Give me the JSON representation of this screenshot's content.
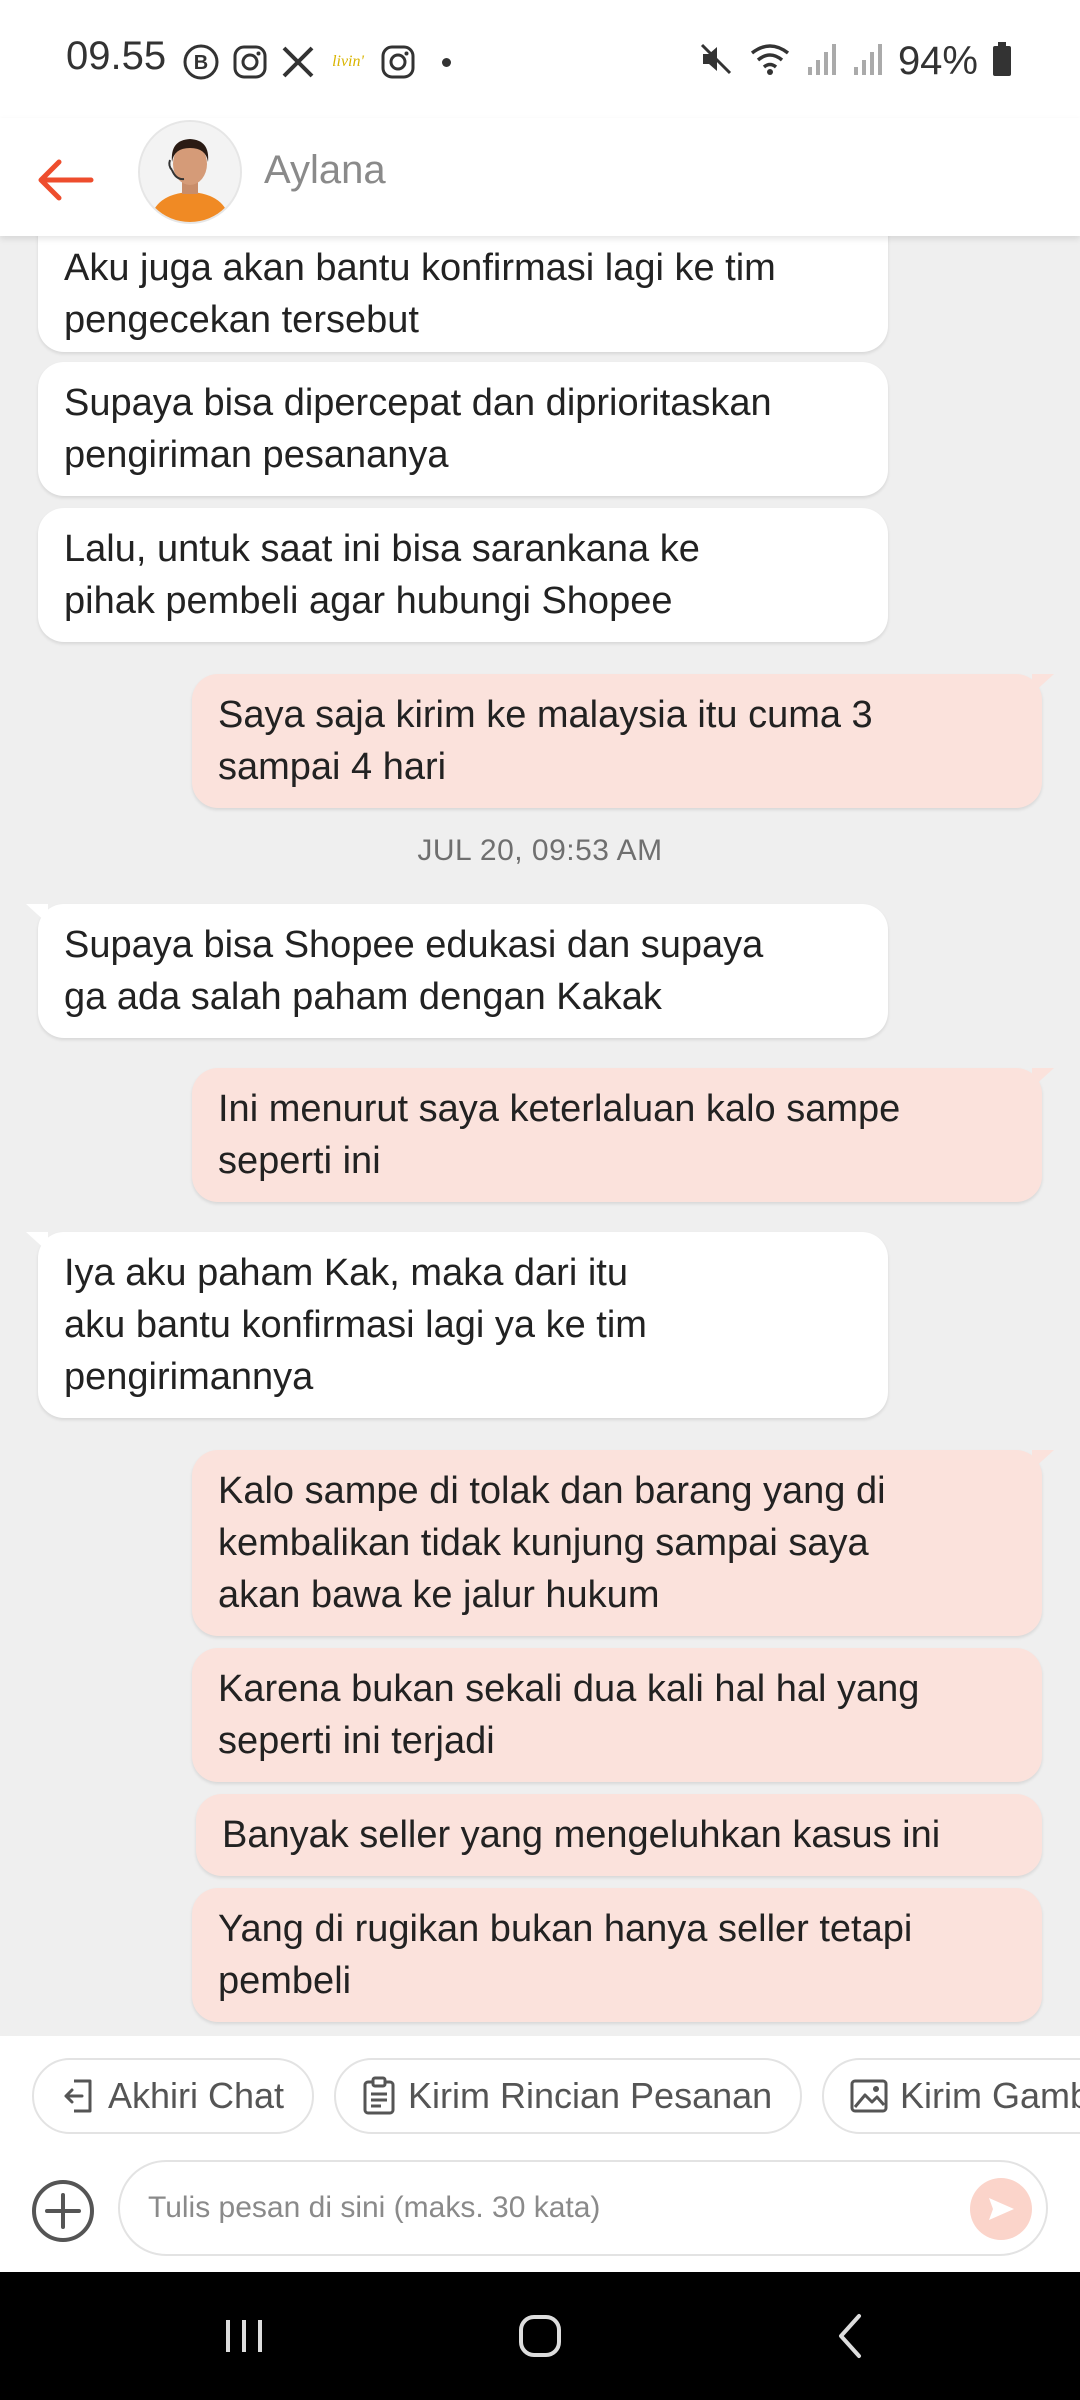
{
  "status_bar": {
    "time": "09.55",
    "battery": "94%",
    "app_icons": [
      "b-badge-icon",
      "instagram-icon",
      "x-icon",
      "livin-icon",
      "instagram-icon"
    ],
    "system_icons": [
      "mute-icon",
      "wifi-icon",
      "signal-icon",
      "signal-icon",
      "battery-icon"
    ]
  },
  "header": {
    "contact_name": "Aylana",
    "accent_color": "#ee4d2d"
  },
  "messages": [
    {
      "side": "incoming",
      "lines": [
        "Aku juga akan bantu konfirmasi lagi ke tim",
        "pengecekan tersebut"
      ]
    },
    {
      "side": "incoming",
      "lines": [
        "Supaya bisa dipercepat dan diprioritaskan",
        "pengiriman pesananya"
      ]
    },
    {
      "side": "incoming",
      "lines": [
        "Lalu, untuk saat ini bisa sarankana ke",
        "pihak pembeli agar hubungi Shopee"
      ]
    },
    {
      "side": "outgoing",
      "lines": [
        "Saya saja kirim ke malaysia itu cuma 3",
        "sampai 4 hari"
      ]
    },
    {
      "side": "incoming",
      "lines": [
        "Supaya bisa Shopee edukasi dan supaya",
        "ga ada salah paham dengan Kakak"
      ]
    },
    {
      "side": "outgoing",
      "lines": [
        "Ini menurut saya keterlaluan kalo sampe",
        "seperti ini"
      ]
    },
    {
      "side": "incoming",
      "lines": [
        "Iya aku paham Kak, maka dari itu",
        "aku bantu konfirmasi lagi ya ke tim",
        "pengirimannya"
      ]
    },
    {
      "side": "outgoing",
      "lines": [
        "Kalo sampe di tolak dan barang yang di",
        "kembalikan tidak kunjung sampai saya",
        "akan bawa ke jalur hukum"
      ]
    },
    {
      "side": "outgoing",
      "lines": [
        "Karena bukan sekali dua kali hal hal yang",
        "seperti ini terjadi"
      ]
    },
    {
      "side": "outgoing",
      "lines": [
        "Banyak seller yang mengeluhkan kasus ini"
      ]
    },
    {
      "side": "outgoing",
      "lines": [
        "Yang di rugikan bukan hanya seller tetapi",
        "pembeli"
      ]
    }
  ],
  "timestamp": "JUL 20, 09:53 AM",
  "quick_actions": [
    {
      "label": "Akhiri Chat",
      "icon": "exit-chat-icon"
    },
    {
      "label": "Kirim Rincian Pesanan",
      "icon": "clipboard-icon"
    },
    {
      "label": "Kirim Gambar",
      "icon": "image-icon"
    }
  ],
  "composer": {
    "placeholder": "Tulis pesan di sini (maks. 30 kata)"
  },
  "nav": {
    "icons": [
      "recent-apps-icon",
      "home-icon",
      "back-nav-icon"
    ]
  }
}
